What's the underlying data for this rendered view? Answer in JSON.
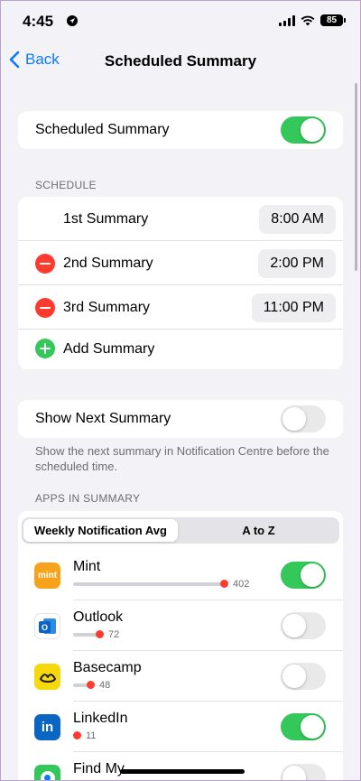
{
  "status": {
    "time": "4:45",
    "battery": "85"
  },
  "nav": {
    "back_label": "Back",
    "title": "Scheduled Summary"
  },
  "main_toggle": {
    "label": "Scheduled Summary",
    "on": true
  },
  "schedule": {
    "header": "SCHEDULE",
    "items": [
      {
        "label": "1st Summary",
        "time": "8:00 AM",
        "removable": false
      },
      {
        "label": "2nd Summary",
        "time": "2:00 PM",
        "removable": true
      },
      {
        "label": "3rd Summary",
        "time": "11:00 PM",
        "removable": true
      }
    ],
    "add_label": "Add Summary"
  },
  "next_summary": {
    "label": "Show Next Summary",
    "on": false,
    "footer": "Show the next summary in Notification Centre before the scheduled time."
  },
  "apps": {
    "header": "APPS IN SUMMARY",
    "segments": [
      "Weekly Notification Avg",
      "A to Z"
    ],
    "selected_segment": 0,
    "list": [
      {
        "name": "Mint",
        "value": "402",
        "on": true,
        "icon": "mint-icon",
        "icon_text": "mint",
        "color": "#f7a21b"
      },
      {
        "name": "Outlook",
        "value": "72",
        "on": false,
        "icon": "outlook-icon",
        "icon_text": "O",
        "color": "#0a64c8"
      },
      {
        "name": "Basecamp",
        "value": "48",
        "on": false,
        "icon": "basecamp-icon",
        "icon_text": "",
        "color": "#f5d90a"
      },
      {
        "name": "LinkedIn",
        "value": "11",
        "on": true,
        "icon": "linkedin-icon",
        "icon_text": "in",
        "color": "#0a66c2"
      },
      {
        "name": "Find My",
        "value": "",
        "on": false,
        "icon": "find-my-icon",
        "icon_text": "",
        "color": "#34c759"
      }
    ]
  },
  "colors": {
    "accent": "#0a7aff",
    "toggle_on": "#34c759",
    "destructive": "#ff3b30"
  }
}
